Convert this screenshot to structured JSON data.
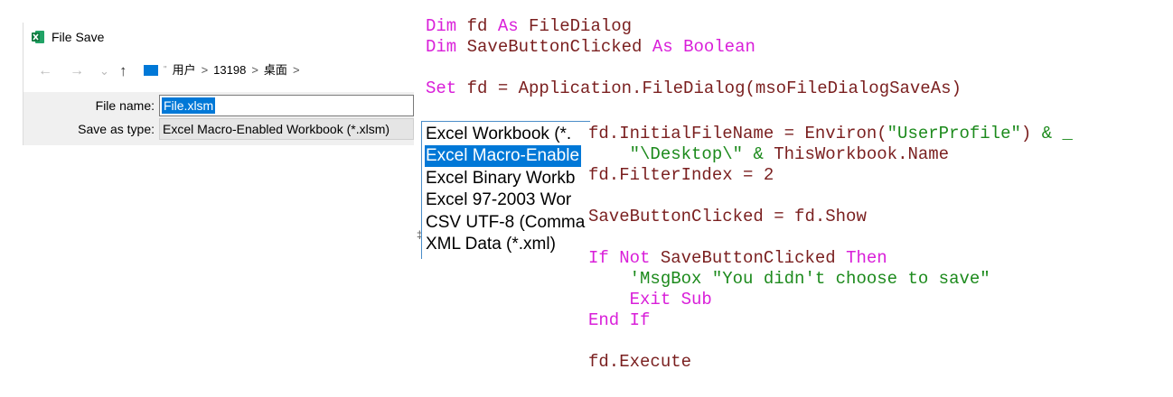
{
  "dialog": {
    "title": "File Save",
    "address": {
      "root": "用户",
      "user": "13198",
      "folder": "桌面",
      "overflow": "\""
    },
    "nav": {
      "back": "←",
      "forward": "→",
      "recent": "⌄",
      "up": "↑",
      "sep": ">"
    },
    "file_name_label": "File name:",
    "file_name_value": "File.xlsm",
    "save_as_type_label": "Save as type:",
    "save_as_type_value": "Excel Macro-Enabled Workbook (*.xlsm)"
  },
  "dropdown": {
    "items": [
      "Excel Workbook (*.",
      "Excel Macro-Enable",
      "Excel Binary Workb",
      "Excel 97-2003 Wor",
      "CSV UTF-8 (Comma",
      "XML Data (*.xml)"
    ],
    "selected_index": 1,
    "handle": "‡"
  },
  "code": {
    "t1": "Dim",
    "t2": " fd ",
    "t3": "As",
    "t4": " FileDialog",
    "t5": "Dim",
    "t6": " SaveButtonClicked ",
    "t7": "As",
    "t8": " Boolean",
    "t9": "Set",
    "t10": " fd = Application.FileDialog(msoFileDialogSaveAs)",
    "t11": "fd.InitialFileName = Environ(",
    "t12": "\"UserProfile\"",
    "t13": ") ",
    "t14": "& _",
    "t15": "    ",
    "t16": "\"\\Desktop\\\"",
    "t17": " ",
    "t18": "&",
    "t19": " ThisWorkbook.Name",
    "t20": "fd.FilterIndex = 2",
    "t21": "SaveButtonClicked = fd.Show",
    "t22": "If",
    "t23": " ",
    "t24": "Not",
    "t25": " SaveButtonClicked ",
    "t26": "Then",
    "t27": "    ",
    "t28": "'MsgBox \"You didn't choose to save\"",
    "t29": "    ",
    "t30": "Exit Sub",
    "t31": "End If",
    "t32": "fd.Execute"
  },
  "colors": {
    "keyword": "#d91fd9",
    "string": "#1c8a1c",
    "code": "#7a1f1f",
    "selection": "#0078d7"
  }
}
